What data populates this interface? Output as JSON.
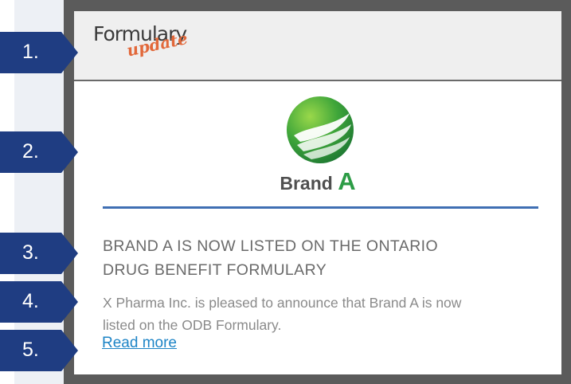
{
  "header": {
    "logo_top": "Formulary",
    "logo_bottom": "update"
  },
  "brand": {
    "name_word": "Brand",
    "name_letter": "A",
    "colors": {
      "logo_green": "#2c9c46",
      "rule_blue": "#3f6fb3"
    }
  },
  "article": {
    "headline_line1": "BRAND A IS NOW LISTED ON THE ONTARIO",
    "headline_line2": "DRUG BENEFIT FORMULARY",
    "body_line1": "X Pharma Inc. is pleased to announce that Brand A is now",
    "body_line2": "listed on the ODB Formulary.",
    "read_more": "Read more"
  },
  "badges": [
    {
      "label": "1."
    },
    {
      "label": "2."
    },
    {
      "label": "3."
    },
    {
      "label": "4."
    },
    {
      "label": "5."
    }
  ],
  "colors": {
    "frame": "#5b5b5b",
    "badge": "#1f3d82",
    "link": "#1d84c6"
  }
}
